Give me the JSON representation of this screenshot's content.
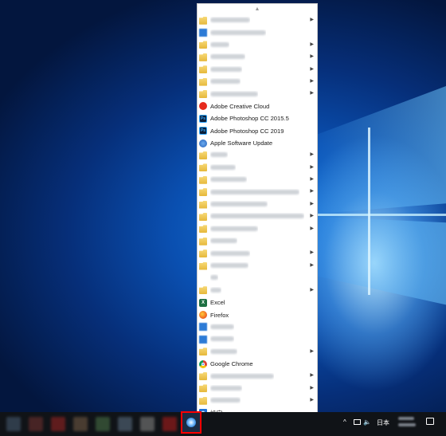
{
  "start_menu": {
    "scroll_up": "▲",
    "scroll_down": "▼",
    "items": [
      {
        "label": "",
        "icon": "folder-icon",
        "submenu": true,
        "blurred": true,
        "bw": 50
      },
      {
        "label": "",
        "icon": "app-icon",
        "submenu": false,
        "blurred": true,
        "bw": 70
      },
      {
        "label": "",
        "icon": "folder-icon",
        "submenu": true,
        "blurred": true,
        "bw": 24
      },
      {
        "label": "",
        "icon": "folder-icon",
        "submenu": true,
        "blurred": true,
        "bw": 44
      },
      {
        "label": "",
        "icon": "folder-icon",
        "submenu": true,
        "blurred": true,
        "bw": 40
      },
      {
        "label": "",
        "icon": "folder-icon",
        "submenu": true,
        "blurred": true,
        "bw": 38
      },
      {
        "label": "",
        "icon": "folder-icon",
        "submenu": true,
        "blurred": true,
        "bw": 60
      },
      {
        "label": "Adobe Creative Cloud",
        "icon": "adobe-creative-cloud-icon",
        "submenu": false
      },
      {
        "label": "Adobe Photoshop CC 2015.5",
        "icon": "photoshop-icon",
        "submenu": false
      },
      {
        "label": "Adobe Photoshop CC 2019",
        "icon": "photoshop-icon",
        "submenu": false
      },
      {
        "label": "Apple Software Update",
        "icon": "apple-software-update-icon",
        "submenu": false
      },
      {
        "label": "",
        "icon": "folder-icon",
        "submenu": true,
        "blurred": true,
        "bw": 22
      },
      {
        "label": "",
        "icon": "folder-icon",
        "submenu": true,
        "blurred": true,
        "bw": 32
      },
      {
        "label": "",
        "icon": "folder-icon",
        "submenu": true,
        "blurred": true,
        "bw": 46
      },
      {
        "label": "",
        "icon": "folder-icon",
        "submenu": true,
        "blurred": true,
        "bw": 112
      },
      {
        "label": "",
        "icon": "folder-icon",
        "submenu": true,
        "blurred": true,
        "bw": 72
      },
      {
        "label": "",
        "icon": "folder-icon",
        "submenu": true,
        "blurred": true,
        "bw": 118
      },
      {
        "label": "",
        "icon": "folder-icon",
        "submenu": true,
        "blurred": true,
        "bw": 60
      },
      {
        "label": "",
        "icon": "folder-icon",
        "submenu": false,
        "blurred": true,
        "bw": 34
      },
      {
        "label": "",
        "icon": "folder-icon",
        "submenu": true,
        "blurred": true,
        "bw": 50
      },
      {
        "label": "",
        "icon": "folder-icon",
        "submenu": true,
        "blurred": true,
        "bw": 48
      },
      {
        "label": "",
        "icon": "blank-icon",
        "submenu": false,
        "blurred": true,
        "bw": 10
      },
      {
        "label": "",
        "icon": "folder-icon",
        "submenu": true,
        "blurred": true,
        "bw": 14
      },
      {
        "label": "Excel",
        "icon": "excel-icon",
        "submenu": false
      },
      {
        "label": "Firefox",
        "icon": "firefox-icon",
        "submenu": false
      },
      {
        "label": "",
        "icon": "app-icon",
        "submenu": false,
        "blurred": true,
        "bw": 30
      },
      {
        "label": "",
        "icon": "app-icon",
        "submenu": false,
        "blurred": true,
        "bw": 30
      },
      {
        "label": "",
        "icon": "folder-icon",
        "submenu": true,
        "blurred": true,
        "bw": 34
      },
      {
        "label": "Google Chrome",
        "icon": "chrome-icon",
        "submenu": false
      },
      {
        "label": "",
        "icon": "folder-icon",
        "submenu": true,
        "blurred": true,
        "bw": 80
      },
      {
        "label": "",
        "icon": "folder-icon",
        "submenu": true,
        "blurred": true,
        "bw": 40
      },
      {
        "label": "",
        "icon": "folder-icon",
        "submenu": true,
        "blurred": true,
        "bw": 38
      },
      {
        "label": "設定",
        "icon": "settings-icon",
        "submenu": false
      }
    ]
  },
  "taskbar": {
    "apps": [
      "blurred-app-1",
      "blurred-app-2",
      "blurred-app-3",
      "blurred-app-4",
      "blurred-app-5",
      "blurred-app-6",
      "blurred-app-7",
      "blurred-app-8"
    ],
    "tray": {
      "chevron": "^",
      "volume": "🔈",
      "language": "日本"
    },
    "colors": {
      "highlight_border": "#ff0000"
    }
  }
}
